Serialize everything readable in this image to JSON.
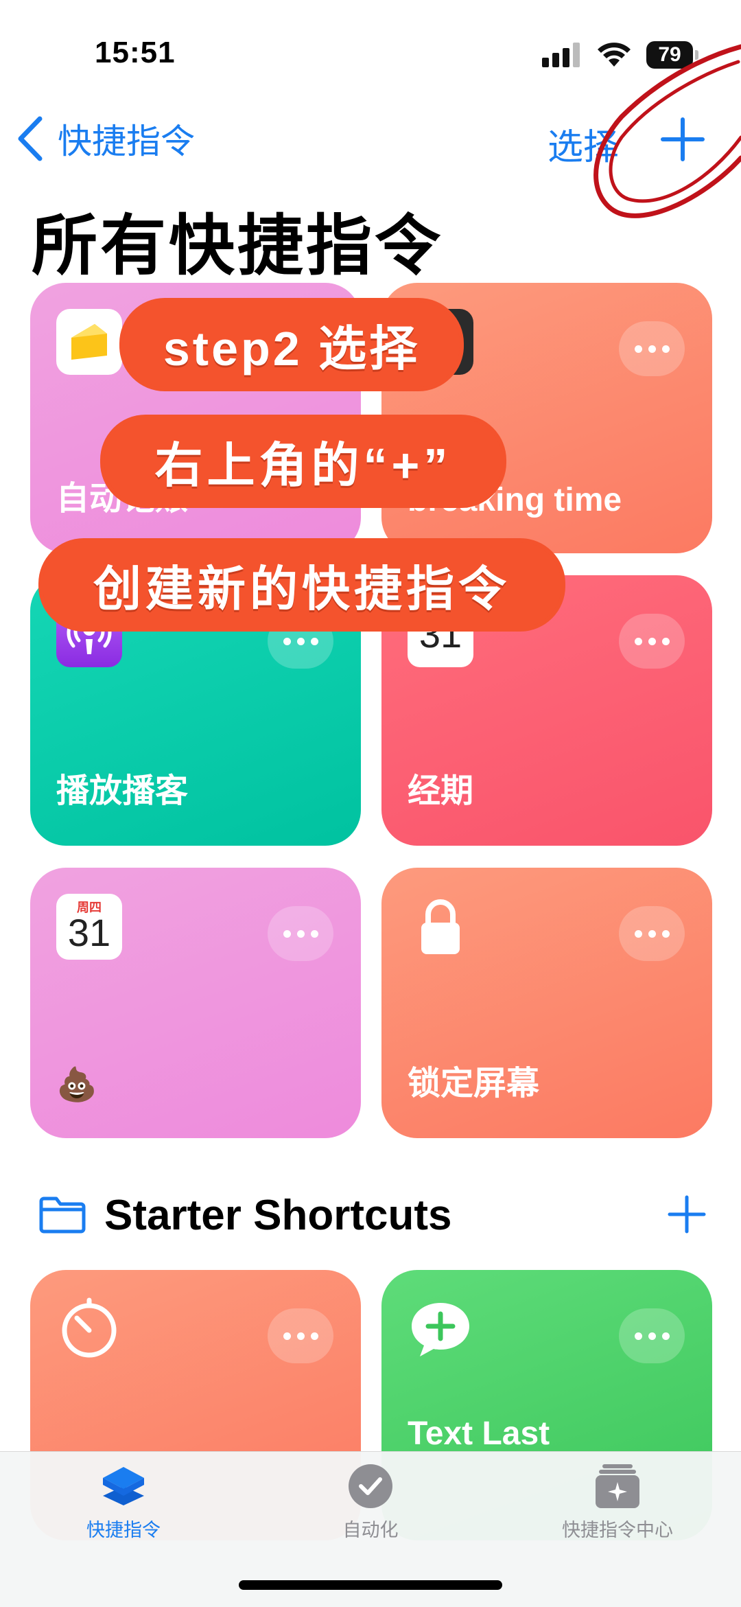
{
  "status_bar": {
    "time": "15:51",
    "battery": "79"
  },
  "nav": {
    "back_label": "快捷指令",
    "select_label": "选择"
  },
  "page_title": "所有快捷指令",
  "tiles": [
    {
      "label": "自动记账",
      "color": "#ee8bdc"
    },
    {
      "label": "breaking time",
      "color": "#fc7a62"
    },
    {
      "label": "播放播客",
      "color": "#00c2a0"
    },
    {
      "label": "经期",
      "color": "#f9546b",
      "calendar_day": "31"
    },
    {
      "label": "💩",
      "color": "#ee8bdc",
      "calendar_weekday": "周四",
      "calendar_day": "31"
    },
    {
      "label": "锁定屏幕",
      "color": "#fc7a62"
    },
    {
      "label": "",
      "color": "#fc7a62"
    },
    {
      "label": "Text Last",
      "color": "#3cc65b"
    }
  ],
  "overlay": {
    "line1": "step2 选择",
    "line2": "右上角的“+”",
    "line3": "创建新的快捷指令"
  },
  "section": {
    "title": "Starter Shortcuts"
  },
  "tabbar": {
    "items": [
      {
        "label": "快捷指令",
        "active": true
      },
      {
        "label": "自动化",
        "active": false
      },
      {
        "label": "快捷指令中心",
        "active": false
      }
    ]
  },
  "colors": {
    "accent": "#1a7df0",
    "annotation_red": "#c0121a",
    "sticker": "#f4532d"
  }
}
